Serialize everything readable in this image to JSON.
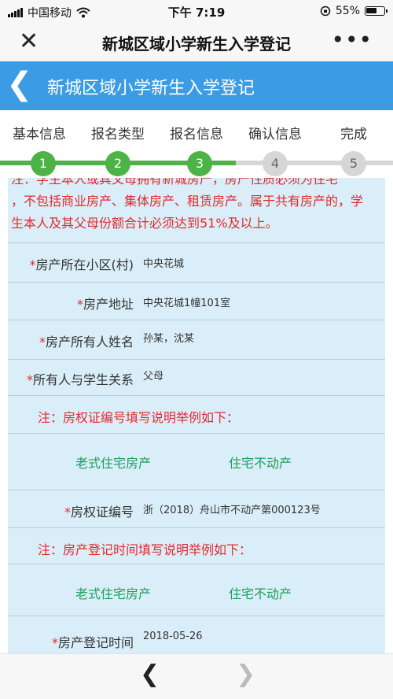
{
  "status_bar": {
    "carrier": "中国移动",
    "time": "下午 7:19",
    "battery": "55%",
    "battery_level": 0.55
  },
  "wechat_bar": {
    "title": "新城区域小学新生入学登记",
    "close_icon": "close-icon",
    "more_icon": "more-icon"
  },
  "app_header": {
    "title": "新城区域小学新生入学登记",
    "back_icon": "chevron-left-icon"
  },
  "steps": {
    "items": [
      {
        "label": "基本信息",
        "number": "1",
        "done": true
      },
      {
        "label": "报名类型",
        "number": "2",
        "done": true
      },
      {
        "label": "报名信息",
        "number": "3",
        "done": true
      },
      {
        "label": "确认信息",
        "number": "4",
        "done": false
      },
      {
        "label": "完成",
        "number": "5",
        "done": false
      }
    ],
    "colors": {
      "done": "#4db346",
      "todo": "#d6d6d6"
    }
  },
  "form": {
    "top_note": {
      "line1": "注：学生本人或其父母拥有新城房产，房产性质必须为住宅",
      "line2": "，不包括商业房产、集体房产、租赁房产。属于共有房产的，学",
      "line3": "生本人及其父母份额合计必须达到51%及以上。"
    },
    "fields": [
      {
        "label": "房产所在小区(村)",
        "value": "中央花城"
      },
      {
        "label": "房产地址",
        "value": "中央花城1幢101室"
      },
      {
        "label": "房产所有人姓名",
        "value": "孙某，沈某"
      },
      {
        "label": "所有人与学生关系",
        "value": "父母"
      }
    ],
    "cert_note": "注：房权证编号填写说明举例如下：",
    "cert_examples": {
      "left": "老式住宅房产",
      "right": "住宅不动产"
    },
    "cert_field": {
      "label": "房权证编号",
      "value": "浙（2018）舟山市不动产第000123号"
    },
    "date_note": "注：房产登记时间填写说明举例如下：",
    "date_examples": {
      "left": "老式住宅房产",
      "right": "住宅不动产"
    },
    "date_field": {
      "label": "房产登记时间",
      "value": "2018-05-26"
    },
    "required_mark": "*"
  },
  "bottom_nav": {
    "back_icon": "chevron-left-icon",
    "forward_icon": "chevron-right-icon"
  },
  "colors": {
    "header_blue": "#3b9be3",
    "form_bg": "#d9eef8",
    "note_red": "#e5292d",
    "example_green": "#1f9e5a"
  }
}
